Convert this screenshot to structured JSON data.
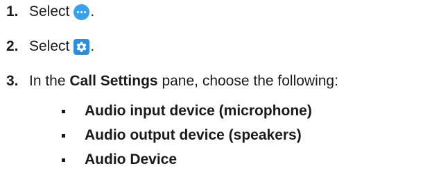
{
  "steps": [
    {
      "number": "1.",
      "text": "Select",
      "icon": "more-options-icon",
      "suffix": "."
    },
    {
      "number": "2.",
      "text": "Select",
      "icon": "settings-gear-icon",
      "suffix": "."
    },
    {
      "number": "3.",
      "prefix": "In the",
      "bold": "Call Settings",
      "suffix": "pane, choose the following:"
    }
  ],
  "options": [
    "Audio input device (microphone)",
    "Audio output device (speakers)",
    "Audio Device"
  ],
  "colors": {
    "more_icon_bg": "#3aa0e8",
    "gear_icon_bg": "#2b8fe0",
    "text": "#1a1a1a"
  }
}
